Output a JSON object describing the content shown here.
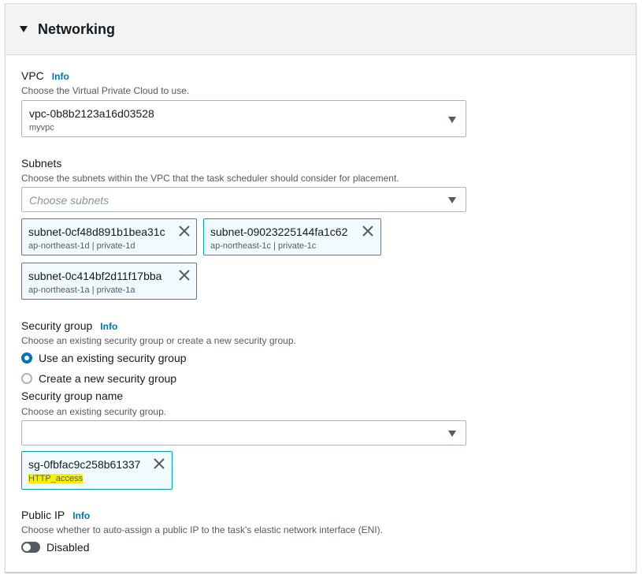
{
  "section": {
    "title": "Networking"
  },
  "vpc": {
    "label": "VPC",
    "info": "Info",
    "description": "Choose the Virtual Private Cloud to use.",
    "selected_id": "vpc-0b8b2123a16d03528",
    "selected_name": "myvpc"
  },
  "subnets": {
    "label": "Subnets",
    "description": "Choose the subnets within the VPC that the task scheduler should consider for placement.",
    "placeholder": "Choose subnets",
    "tokens": [
      {
        "id": "subnet-0cf48d891b1bea31c",
        "detail": "ap-northeast-1d | private-1d"
      },
      {
        "id": "subnet-09023225144fa1c62",
        "detail": "ap-northeast-1c | private-1c"
      },
      {
        "id": "subnet-0c414bf2d11f17bba",
        "detail": "ap-northeast-1a | private-1a"
      }
    ]
  },
  "security_group": {
    "label": "Security group",
    "info": "Info",
    "description": "Choose an existing security group or create a new security group.",
    "options": [
      {
        "label": "Use an existing security group",
        "selected": true
      },
      {
        "label": "Create a new security group",
        "selected": false
      }
    ],
    "name_label": "Security group name",
    "name_description": "Choose an existing security group.",
    "select_value": "",
    "tokens": [
      {
        "id": "sg-0fbfac9c258b61337",
        "detail": "HTTP_access"
      }
    ]
  },
  "public_ip": {
    "label": "Public IP",
    "info": "Info",
    "description": "Choose whether to auto-assign a public IP to the task's elastic network interface (ENI).",
    "toggle_label": "Disabled",
    "enabled": false
  },
  "colors": {
    "link": "#0073bb",
    "token_border": "#00a1c9",
    "token_bg": "#f1faff",
    "highlight": "#f6f000"
  },
  "icons": [
    "caret-down-icon",
    "dropdown-arrow-icon",
    "close-icon"
  ]
}
